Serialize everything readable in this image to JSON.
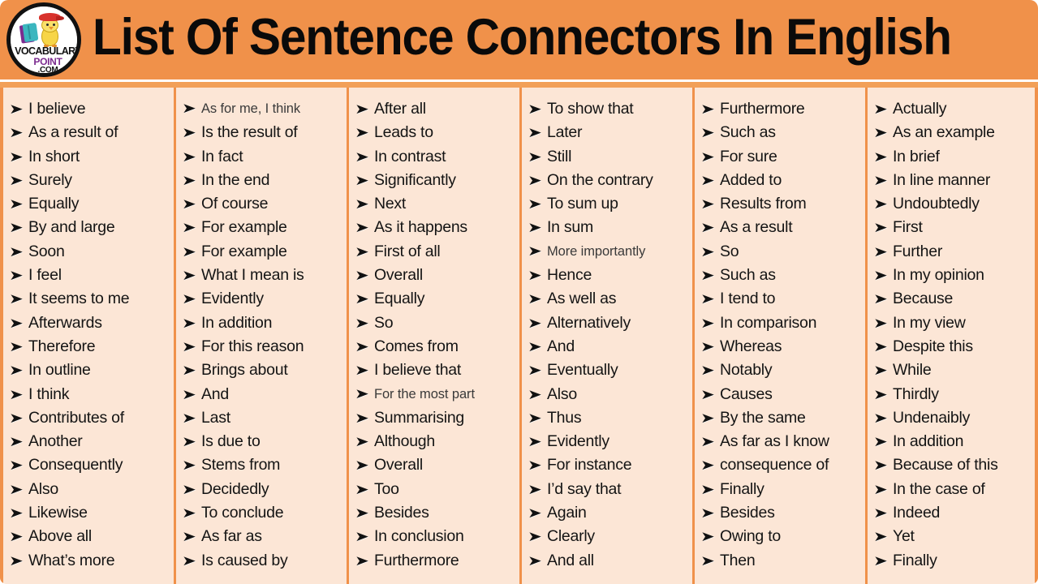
{
  "header": {
    "title": "List Of Sentence Connectors In English",
    "background_color": "#f0914a",
    "logo": {
      "name": "vocabulary-point-logo",
      "line1": "VOCABULARY",
      "line2": "POINT",
      "line3": ".COM",
      "line1_color": "#111111",
      "line2_color": "#7b2b8f",
      "line3_color": "#111111"
    }
  },
  "body": {
    "background_color": "#fce6d6",
    "divider_color": "#f0914a",
    "bullet_glyph": "➤"
  },
  "columns": [
    {
      "index": 1,
      "items": [
        {
          "text": "I believe",
          "small": false
        },
        {
          "text": "As a result of",
          "small": false
        },
        {
          "text": "In short",
          "small": false
        },
        {
          "text": "Surely",
          "small": false
        },
        {
          "text": "Equally",
          "small": false
        },
        {
          "text": "By and large",
          "small": false
        },
        {
          "text": "Soon",
          "small": false
        },
        {
          "text": "I feel",
          "small": false
        },
        {
          "text": "It seems to me",
          "small": false
        },
        {
          "text": "Afterwards",
          "small": false
        },
        {
          "text": "Therefore",
          "small": false
        },
        {
          "text": "In outline",
          "small": false
        },
        {
          "text": "I think",
          "small": false
        },
        {
          "text": "Contributes of",
          "small": false
        },
        {
          "text": "Another",
          "small": false
        },
        {
          "text": "Consequently",
          "small": false
        },
        {
          "text": "Also",
          "small": false
        },
        {
          "text": "Likewise",
          "small": false
        },
        {
          "text": "Above all",
          "small": false
        },
        {
          "text": "What’s more",
          "small": false
        }
      ]
    },
    {
      "index": 2,
      "items": [
        {
          "text": "As for me, I think",
          "small": true
        },
        {
          "text": "Is the result of",
          "small": false
        },
        {
          "text": "In fact",
          "small": false
        },
        {
          "text": "In the end",
          "small": false
        },
        {
          "text": "Of course",
          "small": false
        },
        {
          "text": "For example",
          "small": false
        },
        {
          "text": "For example",
          "small": false
        },
        {
          "text": "What I mean is",
          "small": false
        },
        {
          "text": "Evidently",
          "small": false
        },
        {
          "text": "In addition",
          "small": false
        },
        {
          "text": "For this reason",
          "small": false
        },
        {
          "text": "Brings about",
          "small": false
        },
        {
          "text": "And",
          "small": false
        },
        {
          "text": "Last",
          "small": false
        },
        {
          "text": "Is due to",
          "small": false
        },
        {
          "text": "Stems from",
          "small": false
        },
        {
          "text": "Decidedly",
          "small": false
        },
        {
          "text": "To conclude",
          "small": false
        },
        {
          "text": "As far as",
          "small": false
        },
        {
          "text": "Is caused by",
          "small": false
        }
      ]
    },
    {
      "index": 3,
      "items": [
        {
          "text": "After all",
          "small": false
        },
        {
          "text": "Leads to",
          "small": false
        },
        {
          "text": "In contrast",
          "small": false
        },
        {
          "text": "Significantly",
          "small": false
        },
        {
          "text": "Next",
          "small": false
        },
        {
          "text": "As it happens",
          "small": false
        },
        {
          "text": "First of all",
          "small": false
        },
        {
          "text": "Overall",
          "small": false
        },
        {
          "text": "Equally",
          "small": false
        },
        {
          "text": "So",
          "small": false
        },
        {
          "text": "Comes from",
          "small": false
        },
        {
          "text": "I believe that",
          "small": false
        },
        {
          "text": "For the most part",
          "small": true
        },
        {
          "text": "Summarising",
          "small": false
        },
        {
          "text": "Although",
          "small": false
        },
        {
          "text": "Overall",
          "small": false
        },
        {
          "text": "Too",
          "small": false
        },
        {
          "text": "Besides",
          "small": false
        },
        {
          "text": "In conclusion",
          "small": false
        },
        {
          "text": "Furthermore",
          "small": false
        }
      ]
    },
    {
      "index": 4,
      "items": [
        {
          "text": "To show that",
          "small": false
        },
        {
          "text": "Later",
          "small": false
        },
        {
          "text": "Still",
          "small": false
        },
        {
          "text": "On the contrary",
          "small": false
        },
        {
          "text": "To sum up",
          "small": false
        },
        {
          "text": "In sum",
          "small": false
        },
        {
          "text": "More importantly",
          "small": true
        },
        {
          "text": "Hence",
          "small": false
        },
        {
          "text": "As well as",
          "small": false
        },
        {
          "text": "Alternatively",
          "small": false
        },
        {
          "text": "And",
          "small": false
        },
        {
          "text": "Eventually",
          "small": false
        },
        {
          "text": "Also",
          "small": false
        },
        {
          "text": "Thus",
          "small": false
        },
        {
          "text": "Evidently",
          "small": false
        },
        {
          "text": "For instance",
          "small": false
        },
        {
          "text": "I’d say that",
          "small": false
        },
        {
          "text": "Again",
          "small": false
        },
        {
          "text": "Clearly",
          "small": false
        },
        {
          "text": "And all",
          "small": false
        }
      ]
    },
    {
      "index": 5,
      "items": [
        {
          "text": "Furthermore",
          "small": false
        },
        {
          "text": "Such as",
          "small": false
        },
        {
          "text": "For sure",
          "small": false
        },
        {
          "text": "Added to",
          "small": false
        },
        {
          "text": "Results from",
          "small": false
        },
        {
          "text": "As a result",
          "small": false
        },
        {
          "text": "So",
          "small": false
        },
        {
          "text": "Such as",
          "small": false
        },
        {
          "text": "I tend to",
          "small": false
        },
        {
          "text": "In comparison",
          "small": false
        },
        {
          "text": "Whereas",
          "small": false
        },
        {
          "text": "Notably",
          "small": false
        },
        {
          "text": "Causes",
          "small": false
        },
        {
          "text": "By the same",
          "small": false
        },
        {
          "text": "As far as I know",
          "small": false
        },
        {
          "text": "consequence of",
          "small": false
        },
        {
          "text": "Finally",
          "small": false
        },
        {
          "text": "Besides",
          "small": false
        },
        {
          "text": "Owing to",
          "small": false
        },
        {
          "text": "Then",
          "small": false
        }
      ]
    },
    {
      "index": 6,
      "items": [
        {
          "text": "Actually",
          "small": false
        },
        {
          "text": "As an example",
          "small": false
        },
        {
          "text": "In brief",
          "small": false
        },
        {
          "text": "In line manner",
          "small": false
        },
        {
          "text": "Undoubtedly",
          "small": false
        },
        {
          "text": "First",
          "small": false
        },
        {
          "text": "Further",
          "small": false
        },
        {
          "text": "In my opinion",
          "small": false
        },
        {
          "text": "Because",
          "small": false
        },
        {
          "text": "In my view",
          "small": false
        },
        {
          "text": "Despite this",
          "small": false
        },
        {
          "text": "While",
          "small": false
        },
        {
          "text": "Thirdly",
          "small": false
        },
        {
          "text": "Undenaibly",
          "small": false
        },
        {
          "text": "In addition",
          "small": false
        },
        {
          "text": "Because of this",
          "small": false
        },
        {
          "text": "In the case of",
          "small": false
        },
        {
          "text": "Indeed",
          "small": false
        },
        {
          "text": "Yet",
          "small": false
        },
        {
          "text": "Finally",
          "small": false
        }
      ]
    }
  ]
}
